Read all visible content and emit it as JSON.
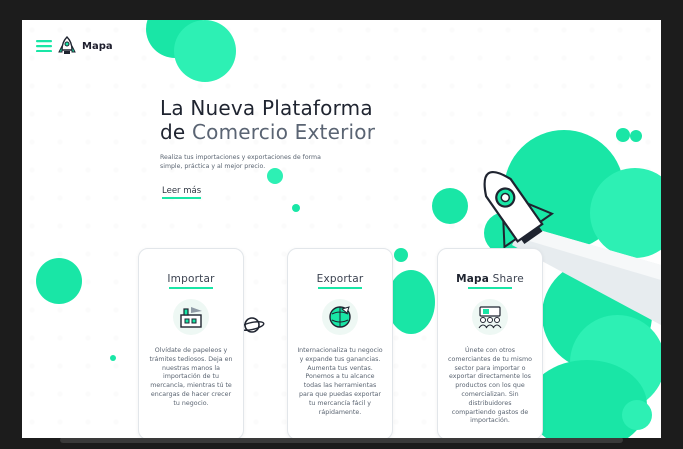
{
  "brand": {
    "name": "Mapa"
  },
  "icons": {
    "menu": "menu-icon",
    "logo": "rocket-logo-icon",
    "rocket": "rocket-illustration",
    "planet": "planet-icon"
  },
  "colors": {
    "accent": "#19e6a6",
    "text_dark": "#1f2430",
    "text_muted": "#5b6572"
  },
  "hero": {
    "title_line1": "La Nueva Plataforma",
    "title_line2_prefix": "de ",
    "title_line2_accent": "Comercio Exterior",
    "subtitle": "Realiza tus importaciones y exportaciones de forma simple, práctica y al mejor precio.",
    "cta": "Leer más"
  },
  "cards": [
    {
      "title": "Importar",
      "text": "Olvídate de papeleos y trámites tediosos. Deja en nuestras manos la importación de tu mercancía, mientras tú te encargas de hacer crecer tu negocio."
    },
    {
      "title": "Exportar",
      "text": "Internacionaliza tu negocio y expande tus ganancias. Aumenta tus ventas. Ponemos a tu alcance todas las herramientas para que puedas exportar tu mercancía fácil y rápidamente."
    },
    {
      "title_bold": "Mapa",
      "title_rest": " Share",
      "text": "Únete con otros comerciantes de tu mismo sector para importar o exportar directamente los productos con los que comercializan. Sin distribuidores compartiendo gastos de importación."
    }
  ]
}
